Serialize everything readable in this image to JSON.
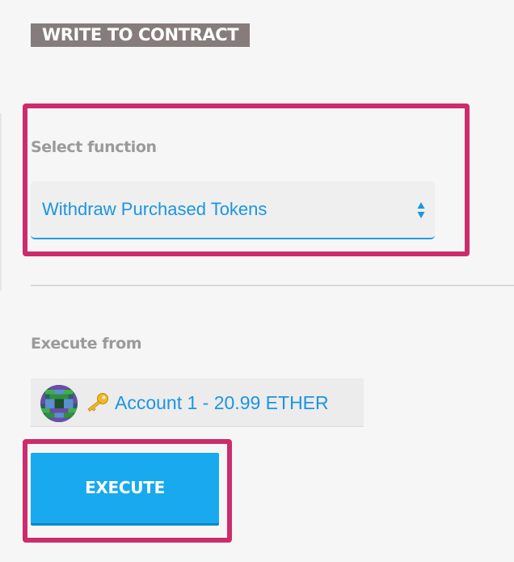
{
  "section": {
    "title": "WRITE TO CONTRACT"
  },
  "function_select": {
    "label": "Select function",
    "selected_value": "Withdraw Purchased Tokens",
    "arrow_icon": "updown-arrows-icon"
  },
  "execute_from": {
    "label": "Execute from",
    "account_label": "Account 1 - 20.99 ETHER",
    "avatar_icon": "identicon-avatar",
    "key_icon": "key-icon"
  },
  "actions": {
    "execute_label": "EXECUTE"
  },
  "colors": {
    "accent_blue": "#18a9ef",
    "link_blue": "#1c95e0",
    "highlight_pink": "#cc2c6b",
    "title_bg": "#857c7b",
    "label_gray": "#9a9a9a"
  }
}
